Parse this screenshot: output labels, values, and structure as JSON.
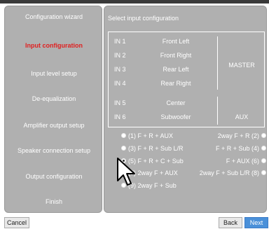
{
  "sidebar": {
    "items": [
      {
        "label": "Configuration wizard"
      },
      {
        "label": "Input configuration"
      },
      {
        "label": "Input level setup"
      },
      {
        "label": "De-equalization"
      },
      {
        "label": "Amplifier output setup"
      },
      {
        "label": "Speaker connection setup"
      },
      {
        "label": "Output configuration"
      },
      {
        "label": "Finish"
      }
    ]
  },
  "main": {
    "title": "Select input configuration",
    "inputs": [
      {
        "in": "IN 1",
        "channel": "Front Left"
      },
      {
        "in": "IN 2",
        "channel": "Front Right"
      },
      {
        "in": "IN 3",
        "channel": "Rear Left"
      },
      {
        "in": "IN 4",
        "channel": "Rear Right"
      },
      {
        "in": "IN 5",
        "channel": "Center"
      },
      {
        "in": "IN 6",
        "channel": "Subwoofer"
      }
    ],
    "group_master": "MASTER",
    "group_aux": "AUX",
    "options_left": [
      {
        "label": "(1) F + R + AUX"
      },
      {
        "label": "(3) F + R + Sub L/R"
      },
      {
        "label": "(5) F + R + C + Sub"
      },
      {
        "label": "(7) 2way F + AUX"
      },
      {
        "label": "(9) 2way F + Sub"
      }
    ],
    "options_right": [
      {
        "label": "2way F + R (2)"
      },
      {
        "label": "F + R + Sub (4)"
      },
      {
        "label": "F + AUX (6)"
      },
      {
        "label": "2way F + Sub L/R (8)"
      }
    ]
  },
  "buttons": {
    "cancel": "Cancel",
    "back": "Back",
    "next": "Next"
  }
}
